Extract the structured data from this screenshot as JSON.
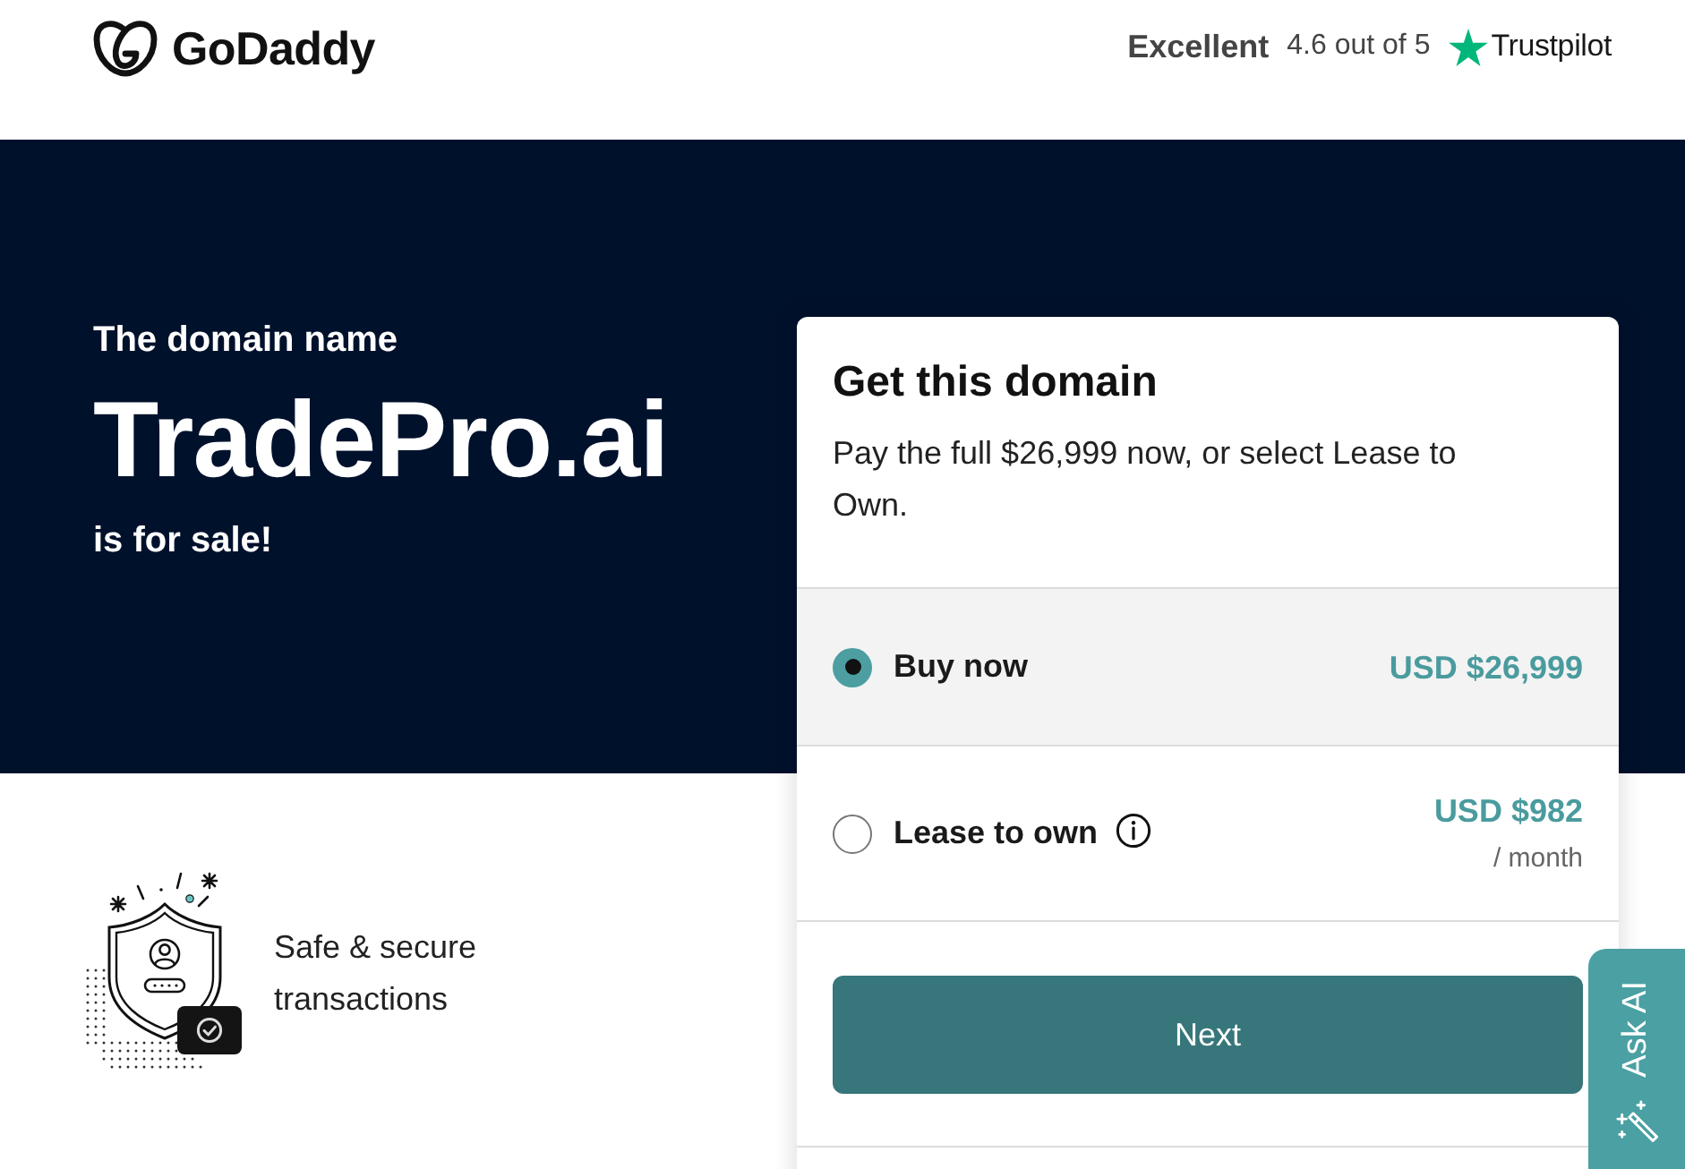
{
  "header": {
    "logo": "GoDaddy",
    "rating": {
      "label": "Excellent",
      "score": "4.6 out of 5",
      "brand": "Trustpilot"
    }
  },
  "hero": {
    "intro": "The domain name",
    "domain": "TradePro.ai",
    "outro": "is for sale!"
  },
  "purchase_card": {
    "title": "Get this domain",
    "description": "Pay the full $26,999 now, or select Lease to Own.",
    "options": [
      {
        "label": "Buy now",
        "price": "USD $26,999",
        "selected": true,
        "info": false
      },
      {
        "label": "Lease to own",
        "price": "USD $982",
        "period": "/ month",
        "selected": false,
        "info": true
      }
    ],
    "button": "Next"
  },
  "features": [
    {
      "text": "Safe & secure transactions"
    }
  ],
  "ask_ai": {
    "label": "Ask AI"
  }
}
